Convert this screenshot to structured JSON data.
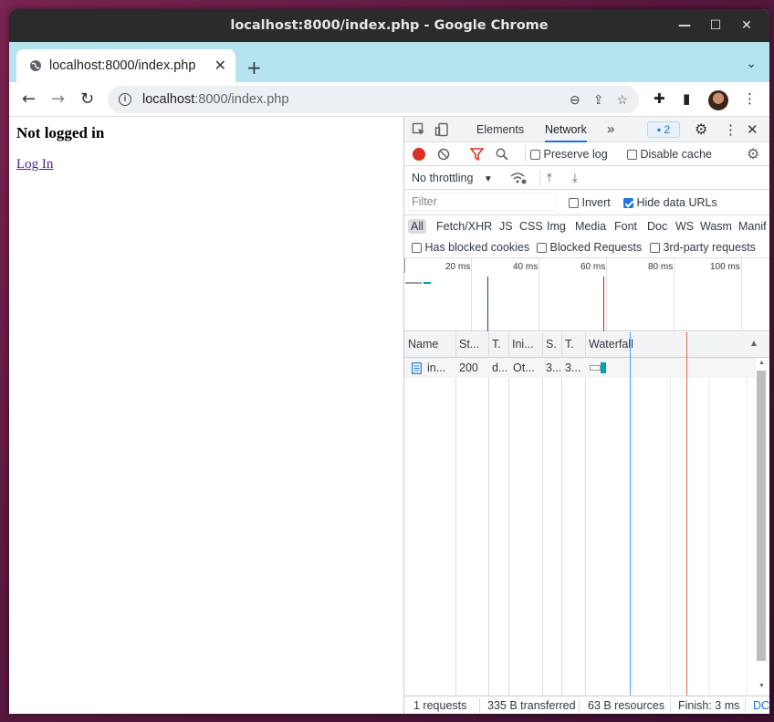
{
  "window": {
    "title": "localhost:8000/index.php - Google Chrome",
    "controls": [
      "—",
      "☐",
      "✕"
    ]
  },
  "tab": {
    "title": "localhost:8000/index.php",
    "close": "✕",
    "new": "+",
    "menu": "⌄"
  },
  "toolbar": {
    "back": "←",
    "forward": "→",
    "reload": "↻",
    "url_host": "localhost",
    "url_rest": ":8000/index.php",
    "zoom_icon": "⊖",
    "share_icon": "⇪",
    "star_icon": "☆",
    "ext_icon": "✚",
    "sidepanel_icon": "▮",
    "menu_icon": "⋮"
  },
  "page": {
    "heading": "Not logged in",
    "link": "Log In"
  },
  "devtools": {
    "tabs": [
      "Elements",
      "Network"
    ],
    "more": "»",
    "issues_count": "2",
    "settings": "⚙",
    "menu": "⋮",
    "close": "✕",
    "preserve_log": "Preserve log",
    "disable_cache": "Disable cache",
    "throttling": "No throttling",
    "filter_placeholder": "Filter",
    "invert": "Invert",
    "hide_data_urls": "Hide data URLs",
    "types": [
      "All",
      "Fetch/XHR",
      "JS",
      "CSS",
      "Img",
      "Media",
      "Font",
      "Doc",
      "WS",
      "Wasm",
      "Manif"
    ],
    "has_blocked_cookies": "Has blocked cookies",
    "blocked_requests": "Blocked Requests",
    "third_party": "3rd-party requests",
    "timeline_ticks": [
      "20 ms",
      "40 ms",
      "60 ms",
      "80 ms",
      "100 ms"
    ],
    "columns": [
      "Name",
      "St...",
      "T.",
      "Ini...",
      "S.",
      "T.",
      "Waterfall"
    ],
    "rows": [
      {
        "name": "in...",
        "status": "200",
        "type": "d...",
        "initiator": "Ot...",
        "size": "3...",
        "time": "3..."
      }
    ],
    "status": {
      "requests": "1 requests",
      "transferred": "335 B transferred",
      "resources": "63 B resources",
      "finish": "Finish: 3 ms",
      "dc": "DC"
    },
    "colors": {
      "accent": "#1a73e8",
      "record": "#d93025",
      "filter": "#d93025",
      "dcl": "#1a73e8",
      "load": "#c5221f"
    }
  }
}
